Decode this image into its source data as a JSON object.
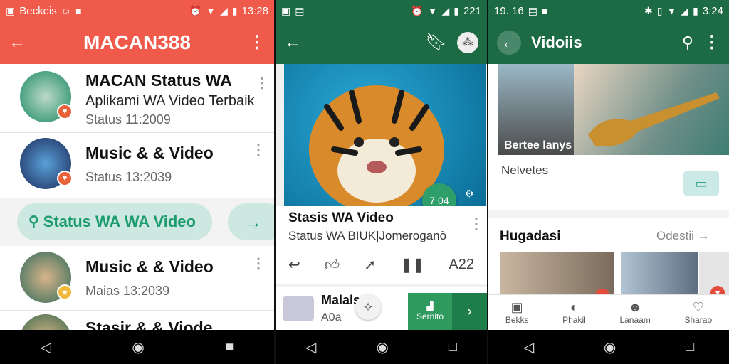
{
  "panel1": {
    "status": {
      "left_text": "Beckeis",
      "time": "13:28"
    },
    "appbar": {
      "title": "MACAN388"
    },
    "rows": [
      {
        "title": "MACAN Status WA",
        "subtitle": "Aplikami WA Video Terbaik",
        "meta": "Status 11:2009"
      },
      {
        "title": "Music & & Video",
        "meta": "Status 13:2039"
      },
      {
        "title": "Music & & Video",
        "meta": "Maias 13:2039"
      },
      {
        "title": "Stasir & & Viode"
      }
    ],
    "search": {
      "label": "Status WA WA Video"
    }
  },
  "panel2": {
    "status": {
      "time": "221"
    },
    "fab": {
      "label": "7 04"
    },
    "card": {
      "title": "Stasis WA Video",
      "subtitle": "Status WA BIUK|Jomeroganò",
      "actions_count": "A22"
    },
    "row": {
      "title": "Malals",
      "subtitle": "A0a",
      "green_button_label": "Sernito"
    }
  },
  "panel3": {
    "status": {
      "left_text": "19. 16",
      "time": "3:24"
    },
    "appbar": {
      "title": "Vidoiis"
    },
    "thumb_caption": "Bertee lanys",
    "info_line": "Nelvetes",
    "section": {
      "heading": "Hugadasi",
      "link": "Odestii"
    },
    "bottom_nav": [
      {
        "icon": "briefcase-icon",
        "label": "Bekks"
      },
      {
        "icon": "chat-icon",
        "label": "Phakil"
      },
      {
        "icon": "person-icon",
        "label": "Lanaam"
      },
      {
        "icon": "heart-icon",
        "label": "Sharao"
      }
    ]
  },
  "colors": {
    "red_accent": "#ef5a4b",
    "green_accent": "#1c6b45",
    "teal_pill": "#cce8e1"
  }
}
